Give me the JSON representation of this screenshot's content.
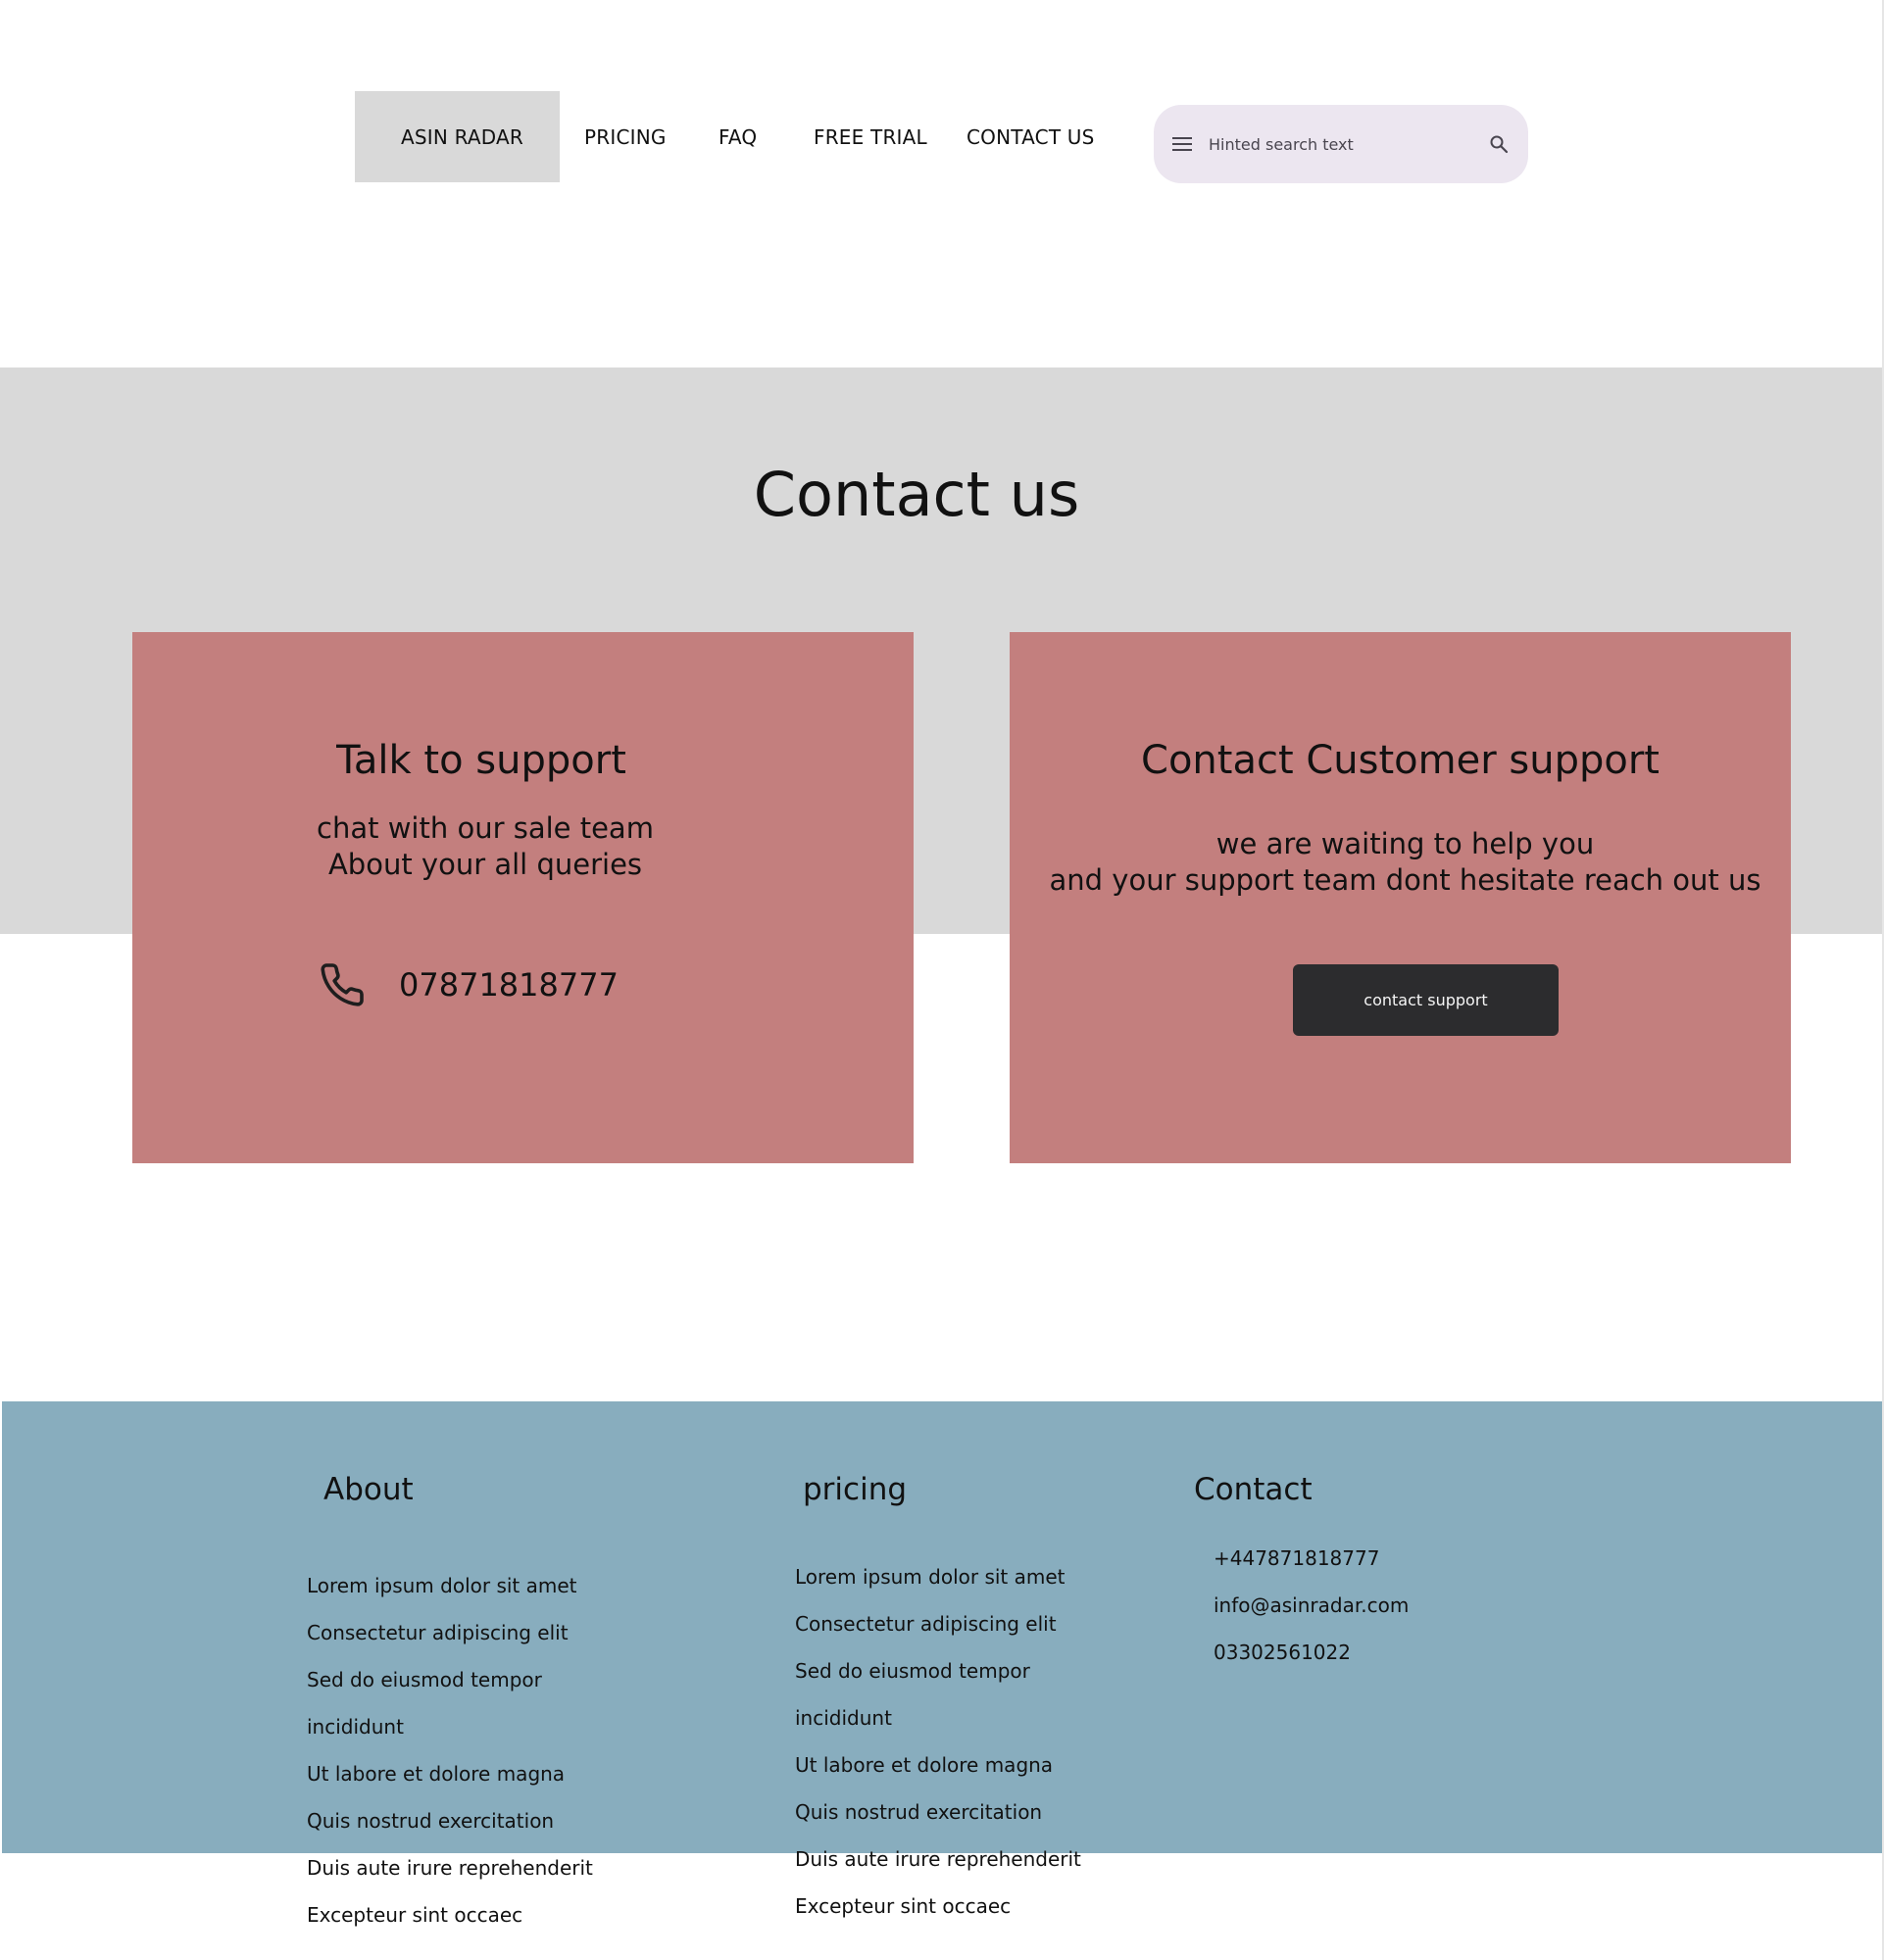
{
  "nav": {
    "items": [
      {
        "label": "ASIN RADAR"
      },
      {
        "label": "PRICING"
      },
      {
        "label": "FAQ"
      },
      {
        "label": "FREE TRIAL"
      },
      {
        "label": "CONTACT US"
      }
    ]
  },
  "search": {
    "placeholder": "Hinted search text",
    "leading_icon": "menu-icon",
    "trailing_icon": "search-icon"
  },
  "hero": {
    "title": "Contact us"
  },
  "cards": {
    "talk": {
      "title": "Talk to support",
      "description_line1": "chat with our sale team",
      "description_line2": "About your all queries",
      "phone_icon": "phone-icon",
      "phone_number": "07871818777"
    },
    "customer": {
      "title": "Contact Customer support",
      "description_line1": "we are waiting to help you",
      "description_line2": "and your support team dont hesitate reach out us",
      "button_label": "contact support"
    }
  },
  "footer": {
    "about": {
      "heading": "About",
      "lines": [
        "Lorem ipsum dolor sit amet",
        "Consectetur adipiscing elit",
        "Sed do eiusmod tempor",
        "incididunt",
        "Ut labore et dolore magna",
        "Quis nostrud exercitation",
        "Duis aute irure  reprehenderit",
        "Excepteur sint occaec"
      ]
    },
    "pricing": {
      "heading": "pricing",
      "lines": [
        "Lorem ipsum dolor sit amet",
        "Consectetur adipiscing elit",
        "Sed do eiusmod tempor",
        "incididunt",
        "Ut labore et dolore magna",
        "Quis nostrud exercitation",
        "Duis aute irure  reprehenderit",
        "Excepteur sint occaec"
      ]
    },
    "contact": {
      "heading": "Contact",
      "phone": "+447871818777",
      "email": "info@asinradar.com",
      "landline": "03302561022"
    }
  },
  "colors": {
    "hero_band": "#d9d9d9",
    "card": "#c37f7e",
    "button": "#2c2c2e",
    "footer": "#88adbe",
    "search_bg": "#ece6f0"
  }
}
